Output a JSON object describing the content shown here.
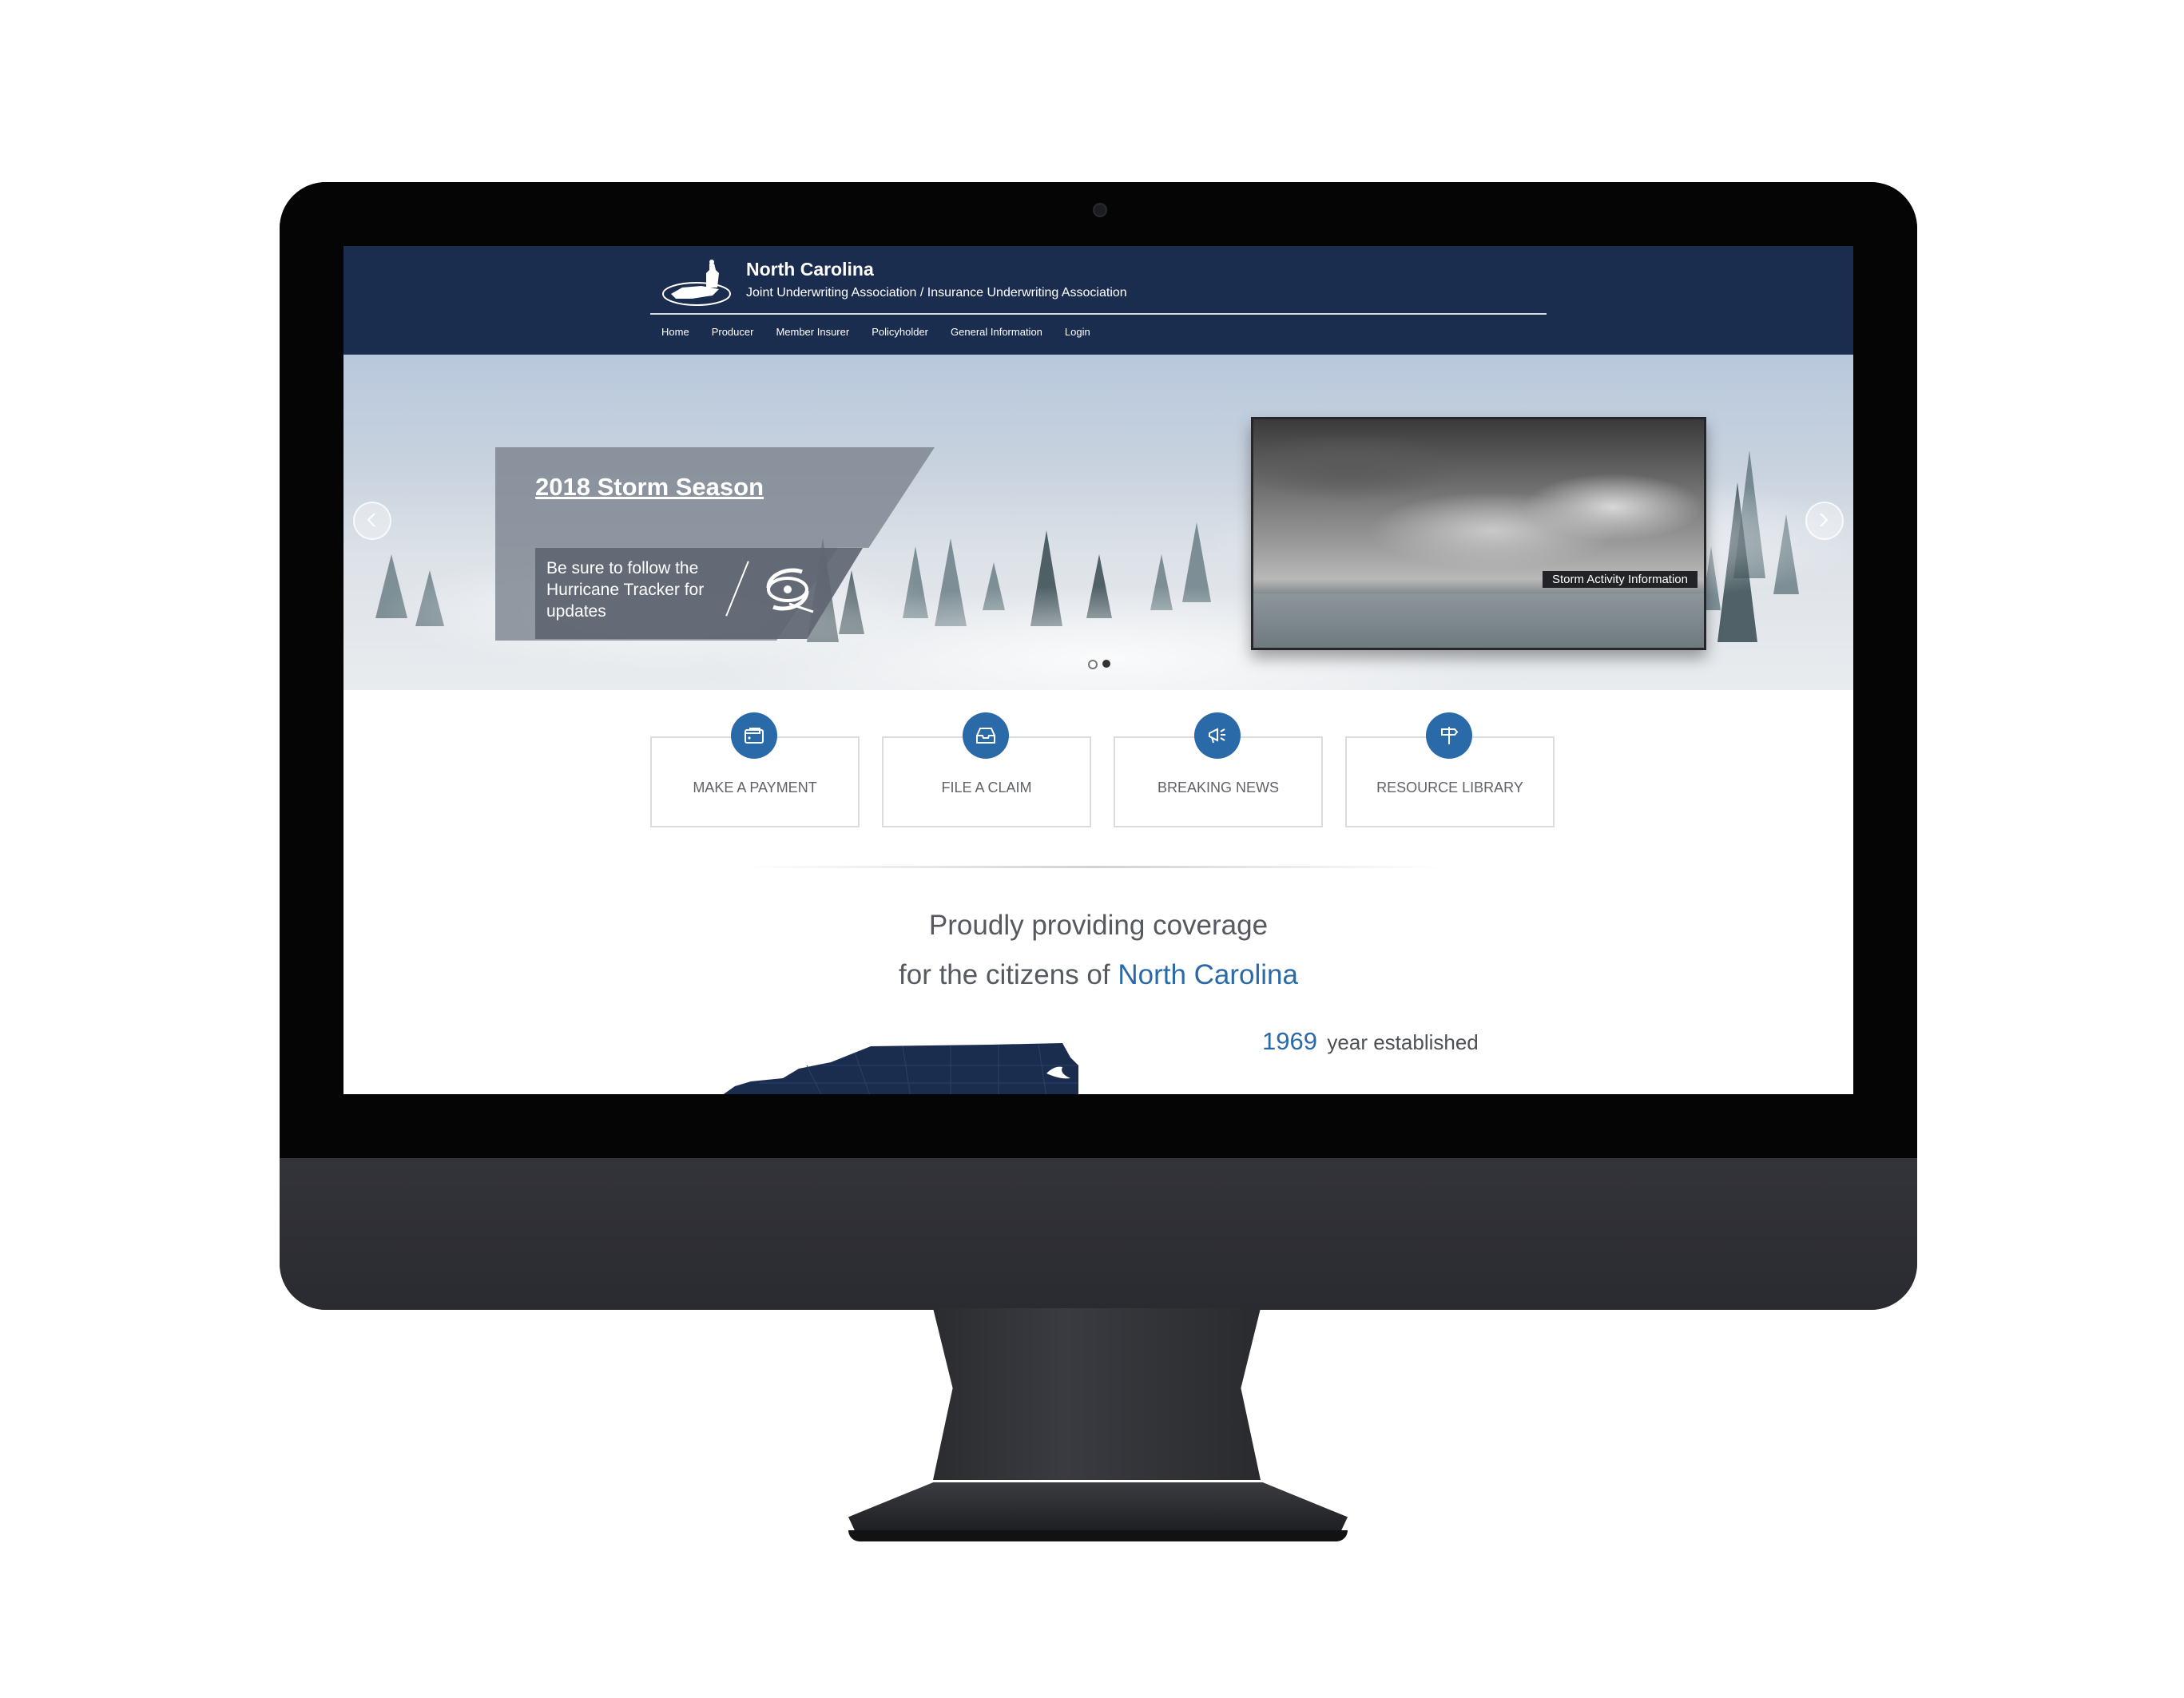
{
  "header": {
    "org_name": "North Carolina",
    "org_subtitle": "Joint Underwriting Association / Insurance Underwriting Association",
    "nav": [
      "Home",
      "Producer",
      "Member Insurer",
      "Policyholder",
      "General Information",
      "Login"
    ]
  },
  "hero": {
    "title": "2018 Storm Season",
    "text": "Be sure to follow the Hurricane Tracker for updates",
    "storm_label": "Storm Activity Information",
    "slide_count": 2,
    "active_slide": 2
  },
  "quick_links": [
    "MAKE A PAYMENT",
    "FILE A CLAIM",
    "BREAKING NEWS",
    "RESOURCE LIBRARY"
  ],
  "tagline": {
    "line1": "Proudly providing coverage",
    "line2_prefix": "for the citizens of",
    "line2_highlight": "North Carolina"
  },
  "stats": [
    {
      "number": "1969",
      "label": "year established"
    }
  ],
  "colors": {
    "header_bg": "#1b2d4e",
    "accent": "#2a6aa8"
  }
}
